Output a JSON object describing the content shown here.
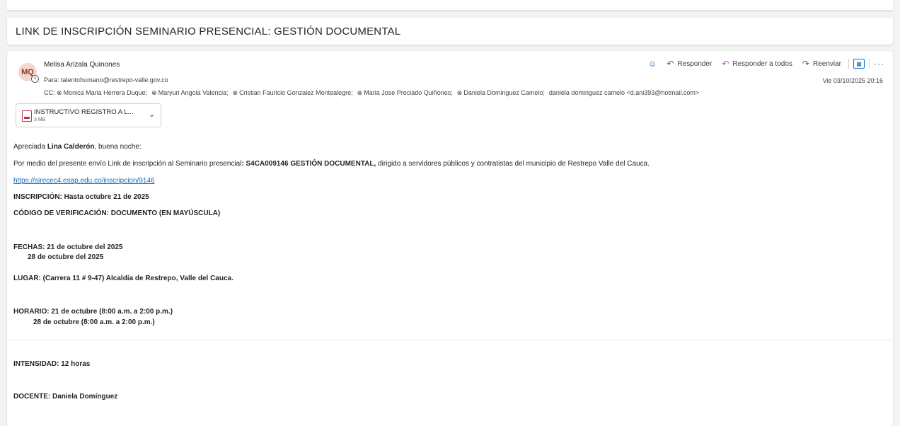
{
  "subject": "LINK DE INSCRIPCIÓN SEMINARIO PRESENCIAL: GESTIÓN DOCUMENTAL",
  "message": {
    "avatar_initials": "MQ",
    "sender": "Melisa Arizala Quinones",
    "to_label": "Para:",
    "to": "talentohumano@restrepo-valle.gov.co",
    "cc_label": "CC:",
    "cc": [
      "Monica Maria Herrera Duque;",
      "Maryuri Angola Valencia;",
      "Cristian Fauricio Gonzalez Montealegre;",
      "Maria Jose Preciado Quiñones;",
      "Daniela Dominguez Camelo;"
    ],
    "cc_external": "daniela dominguez camelo <d.ani393@hotmail.com>",
    "date": "Vie 03/10/2025 20:16"
  },
  "actions": {
    "reply": "Responder",
    "reply_all": "Responder a todos",
    "forward": "Reenviar"
  },
  "attachment": {
    "name": "INSTRUCTIVO REGISTRO A L...",
    "size": "3 MB"
  },
  "body": {
    "greeting_pre": "Apreciada ",
    "greeting_name": "Lina Calderón",
    "greeting_post": ", buena noche:",
    "intro_pre": "Por medio del presente envío Link de inscripción al Seminario presencial",
    "intro_bold": ": S4CA009146 GESTIÓN DOCUMENTAL,",
    "intro_post": " dirigido a servidores públicos y contratistas del municipio de Restrepo Valle del Cauca.",
    "link": "https://sirecec4.esap.edu.co/inscripcion/9146",
    "inscripcion": "INSCRIPCIÓN: Hasta octubre 21 de 2025",
    "codigo": "CÓDIGO DE VERIFICACIÓN: DOCUMENTO (EN MAYÚSCULA)",
    "fechas_1": "FECHAS: 21 de octubre del 2025",
    "fechas_2": "28 de octubre del 2025",
    "lugar": "LUGAR: (Carrera 11 # 9-47) Alcaldía de Restrepo, Valle del Cauca.",
    "horario_1": "HORARIO: 21 de octubre (8:00 a.m. a 2:00 p.m.)",
    "horario_2": "28 de octubre (8:00 a.m. a 2:00 p.m.)",
    "intensidad": "INTENSIDAD: 12 horas",
    "docente": "DOCENTE: Daniela Domínguez"
  },
  "colors": {
    "accent": "#0f6cbd",
    "reply_all": "#b146c2",
    "avatar_bg": "#f4d7d0",
    "attachment_icon": "#c4314b"
  }
}
